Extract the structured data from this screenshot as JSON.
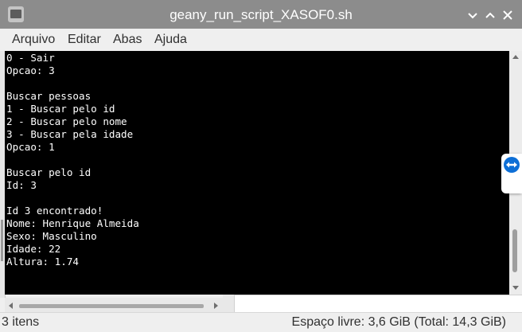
{
  "window": {
    "title": "geany_run_script_XASOF0.sh",
    "buttons": {
      "minimize": "chevron-down-icon",
      "maximize": "chevron-up-icon",
      "close": "close-icon"
    }
  },
  "menu": {
    "items": [
      "Arquivo",
      "Editar",
      "Abas",
      "Ajuda"
    ]
  },
  "terminal": {
    "lines": [
      "0 - Sair",
      "Opcao: 3",
      "",
      "Buscar pessoas",
      "1 - Buscar pelo id",
      "2 - Buscar pelo nome",
      "3 - Buscar pela idade",
      "Opcao: 1",
      "",
      "Buscar pelo id",
      "Id: 3",
      "",
      "Id 3 encontrado!",
      "Nome: Henrique Almeida",
      "Sexo: Masculino",
      "Idade: 22",
      "Altura: 1.74"
    ]
  },
  "status": {
    "items_count": "3 itens",
    "free_space": "Espaço livre: 3,6 GiB (Total: 14,3 GiB)"
  },
  "colors": {
    "titlebar": "#8c8c8c",
    "terminal_bg": "#000000",
    "terminal_fg": "#ffffff",
    "teamviewer_blue": "#0e6fd6"
  }
}
